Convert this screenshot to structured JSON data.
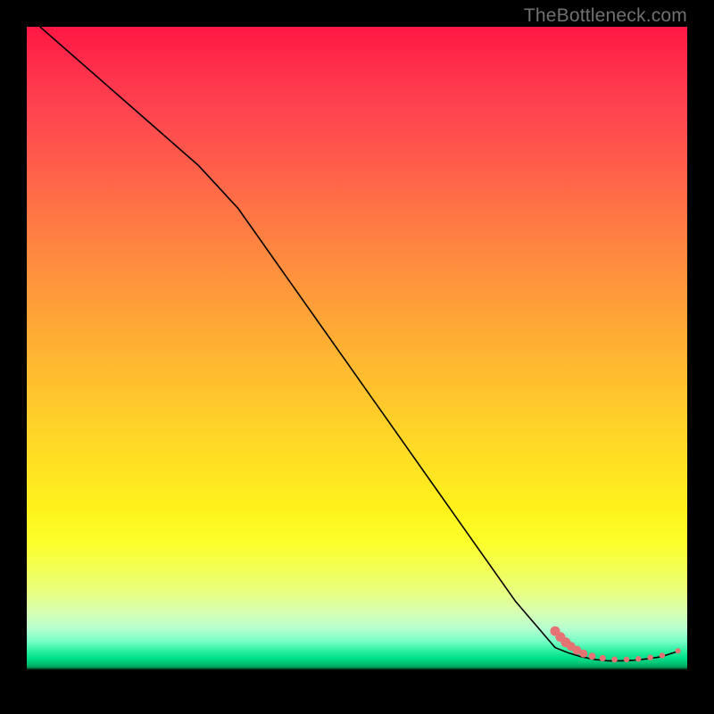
{
  "watermark": "TheBottleneck.com",
  "colors": {
    "background": "#000000",
    "watermark": "#707070",
    "line": "#000000",
    "marker": "#e57373"
  },
  "chart_data": {
    "type": "line",
    "title": "",
    "xlabel": "",
    "ylabel": "",
    "xlim": [
      0,
      100
    ],
    "ylim": [
      0,
      100
    ],
    "grid": false,
    "legend": false,
    "notes": "Bottleneck-style curve over a red→green vertical spectrum. Axes are unlabeled; x,y are normalized 0–100 inside the plot rectangle. y=0 is the bottom (green band).",
    "series": [
      {
        "name": "curve",
        "x": [
          2,
          10,
          18,
          26,
          32,
          38,
          44,
          50,
          56,
          62,
          68,
          74,
          80,
          82,
          84,
          86,
          88,
          90,
          92,
          94,
          96,
          98.5
        ],
        "y": [
          100,
          93,
          86,
          79,
          72.5,
          64,
          55.5,
          47,
          38.5,
          30,
          21.5,
          13,
          6,
          5.2,
          4.6,
          4.2,
          4.0,
          4.0,
          4.1,
          4.3,
          4.6,
          5.4
        ]
      }
    ],
    "markers": {
      "name": "dots",
      "note": "Pink dots tracing the flat bottom part of the curve; r is approximate radius in px.",
      "points": [
        {
          "x": 80.0,
          "y": 8.5,
          "r": 5.5
        },
        {
          "x": 80.8,
          "y": 7.6,
          "r": 5.5
        },
        {
          "x": 81.6,
          "y": 6.8,
          "r": 5.5
        },
        {
          "x": 82.4,
          "y": 6.2,
          "r": 5.0
        },
        {
          "x": 83.3,
          "y": 5.6,
          "r": 5.0
        },
        {
          "x": 84.3,
          "y": 5.1,
          "r": 4.5
        },
        {
          "x": 85.6,
          "y": 4.7,
          "r": 4.0
        },
        {
          "x": 87.2,
          "y": 4.4,
          "r": 3.6
        },
        {
          "x": 89.0,
          "y": 4.2,
          "r": 3.4
        },
        {
          "x": 90.8,
          "y": 4.2,
          "r": 3.2
        },
        {
          "x": 92.6,
          "y": 4.3,
          "r": 3.2
        },
        {
          "x": 94.4,
          "y": 4.5,
          "r": 3.2
        },
        {
          "x": 96.2,
          "y": 4.8,
          "r": 3.2
        },
        {
          "x": 98.6,
          "y": 5.5,
          "r": 3.0
        }
      ]
    }
  }
}
